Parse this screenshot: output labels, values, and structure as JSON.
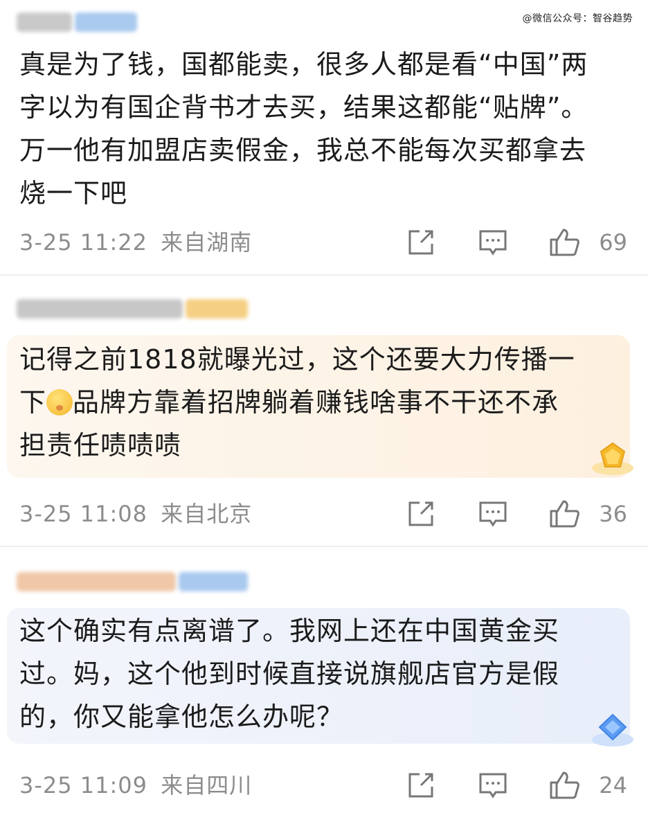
{
  "watermark": "@微信公众号：智谷趋势",
  "comments": [
    {
      "text": "真是为了钱，国都能卖，很多人都是看“中国”两字以为有国企背书才去买，结果这都能“贴牌”。万一他有加盟店卖假金，我总不能每次买都拿去烧一下吧",
      "lines": [
        "真是为了钱，国都能卖，很多人都是看“中国”两",
        "字以为有国企背书才去买，结果这都能“贴牌”。",
        "万一他有加盟店卖假金，我总不能每次买都拿去",
        "烧一下吧"
      ],
      "time": "3-25 11:22",
      "location": "来自湖南",
      "likes": "69"
    },
    {
      "lines": [
        "记得之前1818就曝光过，这个还要大力传播一",
        "下",
        "品牌方靠着招牌躺着赚钱啥事不干还不承",
        "担责任啧啧啧"
      ],
      "time": "3-25 11:08",
      "location": "来自北京",
      "likes": "36",
      "bubble_color": "#fdf4e8",
      "badge_color": "#f5b92b"
    },
    {
      "lines": [
        "这个确实有点离谱了。我网上还在中国黄金买",
        "过。妈，这个他到时候直接说旗舰店官方是假",
        "的，你又能拿他怎么办呢？"
      ],
      "time": "3-25 11:09",
      "location": "来自四川",
      "likes": "24",
      "bubble_color": "#eef2fb",
      "badge_color": "#5b9cf2"
    }
  ]
}
